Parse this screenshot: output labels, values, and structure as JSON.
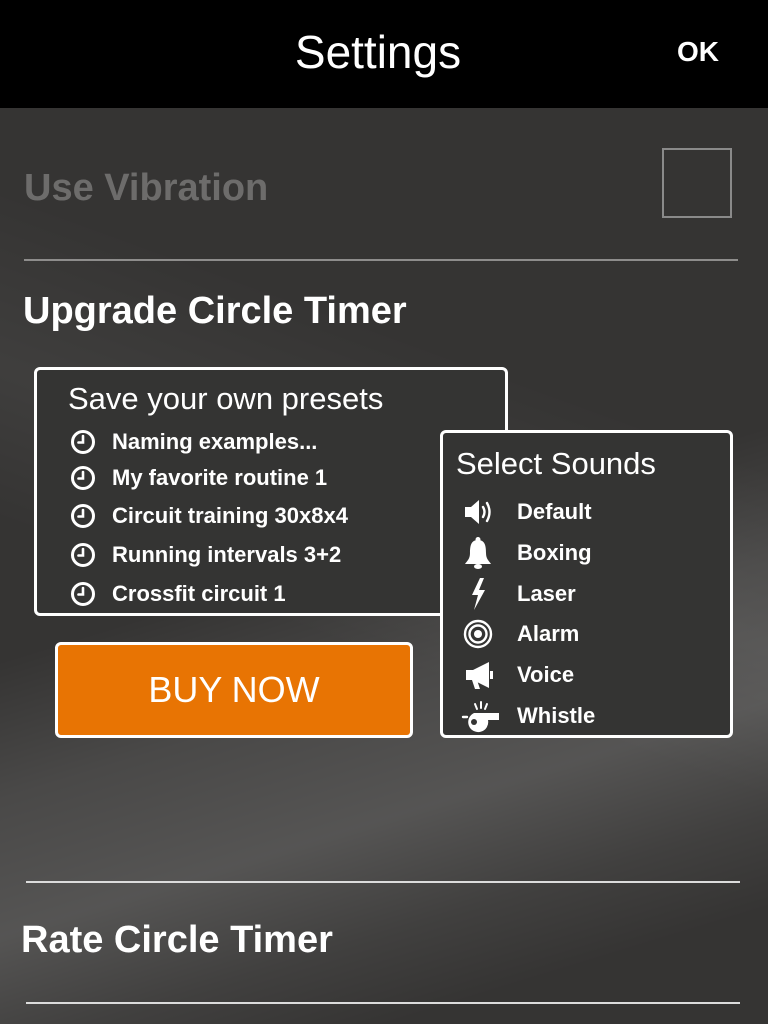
{
  "header": {
    "title": "Settings",
    "ok_label": "OK"
  },
  "vibration": {
    "label": "Use Vibration",
    "checked": false
  },
  "upgrade": {
    "title": "Upgrade Circle Timer",
    "presets": {
      "heading": "Save your own presets",
      "items": [
        "Naming examples...",
        "My favorite routine 1",
        "Circuit training 30x8x4",
        "Running intervals 3+2",
        "Crossfit circuit 1"
      ]
    },
    "sounds": {
      "heading": "Select Sounds",
      "items": [
        {
          "label": "Default",
          "icon": "speaker-icon"
        },
        {
          "label": "Boxing",
          "icon": "bell-icon"
        },
        {
          "label": "Laser",
          "icon": "lightning-icon"
        },
        {
          "label": "Alarm",
          "icon": "target-icon"
        },
        {
          "label": "Voice",
          "icon": "megaphone-icon"
        },
        {
          "label": "Whistle",
          "icon": "whistle-icon"
        }
      ]
    },
    "buy_label": "BUY NOW"
  },
  "rate": {
    "title": "Rate Circle Timer"
  },
  "colors": {
    "header_bg": "#000000",
    "page_bg": "#353433",
    "accent": "#e87403",
    "disabled_text": "#6d6c6b"
  }
}
